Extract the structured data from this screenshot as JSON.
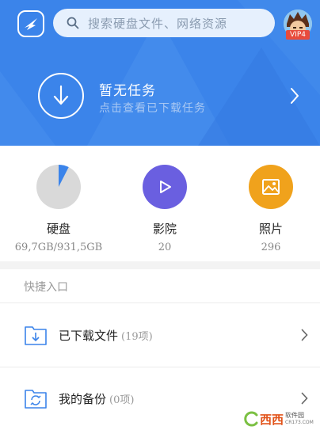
{
  "search": {
    "placeholder": "搜索硬盘文件、网络资源"
  },
  "user": {
    "vip_badge": "VIP4"
  },
  "task_banner": {
    "title": "暂无任务",
    "subtitle": "点击查看已下载任务"
  },
  "stats": [
    {
      "label": "硬盘",
      "value": "69,7GB/931,5GB",
      "icon": "disk-usage-pie-icon",
      "usage_fraction": 0.075,
      "color": "#d9d9d9",
      "accent": "#3b84ea"
    },
    {
      "label": "影院",
      "value": "20",
      "icon": "play-icon",
      "color": "#6a5fe0"
    },
    {
      "label": "照片",
      "value": "296",
      "icon": "image-icon",
      "color": "#f0a21c"
    }
  ],
  "quick_access": {
    "title": "快捷入口",
    "items": [
      {
        "label": "已下载文件",
        "count": "(19项)",
        "icon": "download-folder-icon"
      },
      {
        "label": "我的备份",
        "count": "(0项)",
        "icon": "backup-folder-icon"
      }
    ]
  },
  "watermark": {
    "text": "西西",
    "sub": "软件园",
    "domain": "CR173.COM"
  },
  "colors": {
    "header": "#3b84ea",
    "icon_blue": "#3b84ea"
  }
}
